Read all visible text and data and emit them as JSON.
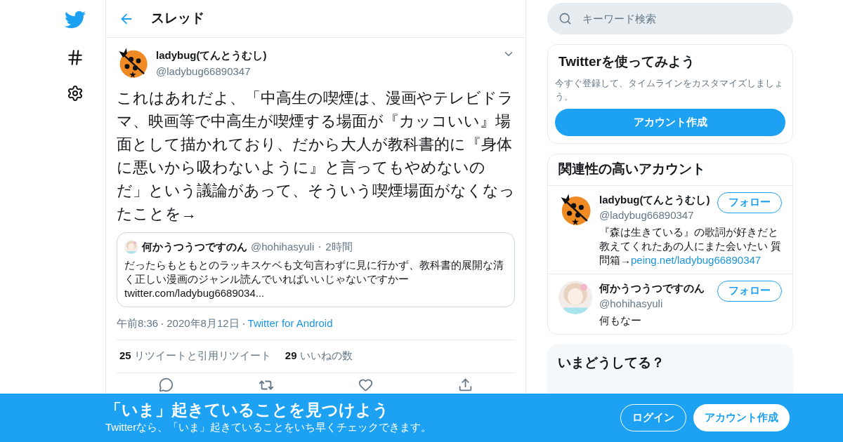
{
  "header": {
    "title": "スレッド"
  },
  "tweet": {
    "name": "ladybug(てんとうむし)",
    "handle": "@ladybug66890347",
    "text": "これはあれだよ、「中高生の喫煙は、漫画やテレビドラマ、映画等で中高生が喫煙する場面が『カッコいい』場面として描かれており、だから大人が教科書的に『身体に悪いから吸わないように』と言ってもやめないのだ」という議論があって、そういう喫煙場面がなくなったことを→",
    "quote": {
      "name": "何かうつうつですのん",
      "handle": "@hohihasyuli",
      "time": "2時間",
      "text": "だったらもともとのラッキスケベも文句言わずに見に行かず、教科書的展開な清く正しい漫画のジャンル読んでいればいいじゃないですかー",
      "link": "twitter.com/ladybug6689034..."
    },
    "time": "午前8:36",
    "date": "2020年8月12日",
    "source": "Twitter for Android",
    "stats": [
      {
        "count": "25",
        "label": "リツイートと引用リツイート"
      },
      {
        "count": "29",
        "label": "いいねの数"
      }
    ]
  },
  "search": {
    "placeholder": "キーワード検索"
  },
  "signup": {
    "title": "Twitterを使ってみよう",
    "text": "今すぐ登録して、タイムラインをカスタマイズしましょう。",
    "button": "アカウント作成"
  },
  "related": {
    "title": "関連性の高いアカウント",
    "accounts": [
      {
        "kind": "ladybug",
        "name": "ladybug(てんとうむし)",
        "handle": "@ladybug66890347",
        "bio": "『森は生きている』の歌詞が好きだと教えてくれたあの人にまた会いたい 質問箱→",
        "link": "peing.net/ladybug66890347",
        "button": "フォロー"
      },
      {
        "kind": "picture",
        "name": "何かうつうつですのん",
        "handle": "@hohihasyuli",
        "bio": "何もなー",
        "button": "フォロー"
      }
    ]
  },
  "trends": {
    "title": "いまどうしてる？"
  },
  "banner": {
    "title": "「いま」起きていることを見つけよう",
    "text": "Twitterなら、「いま」起きていることをいち早くチェックできます。",
    "login": "ログイン",
    "signup": "アカウント作成"
  }
}
